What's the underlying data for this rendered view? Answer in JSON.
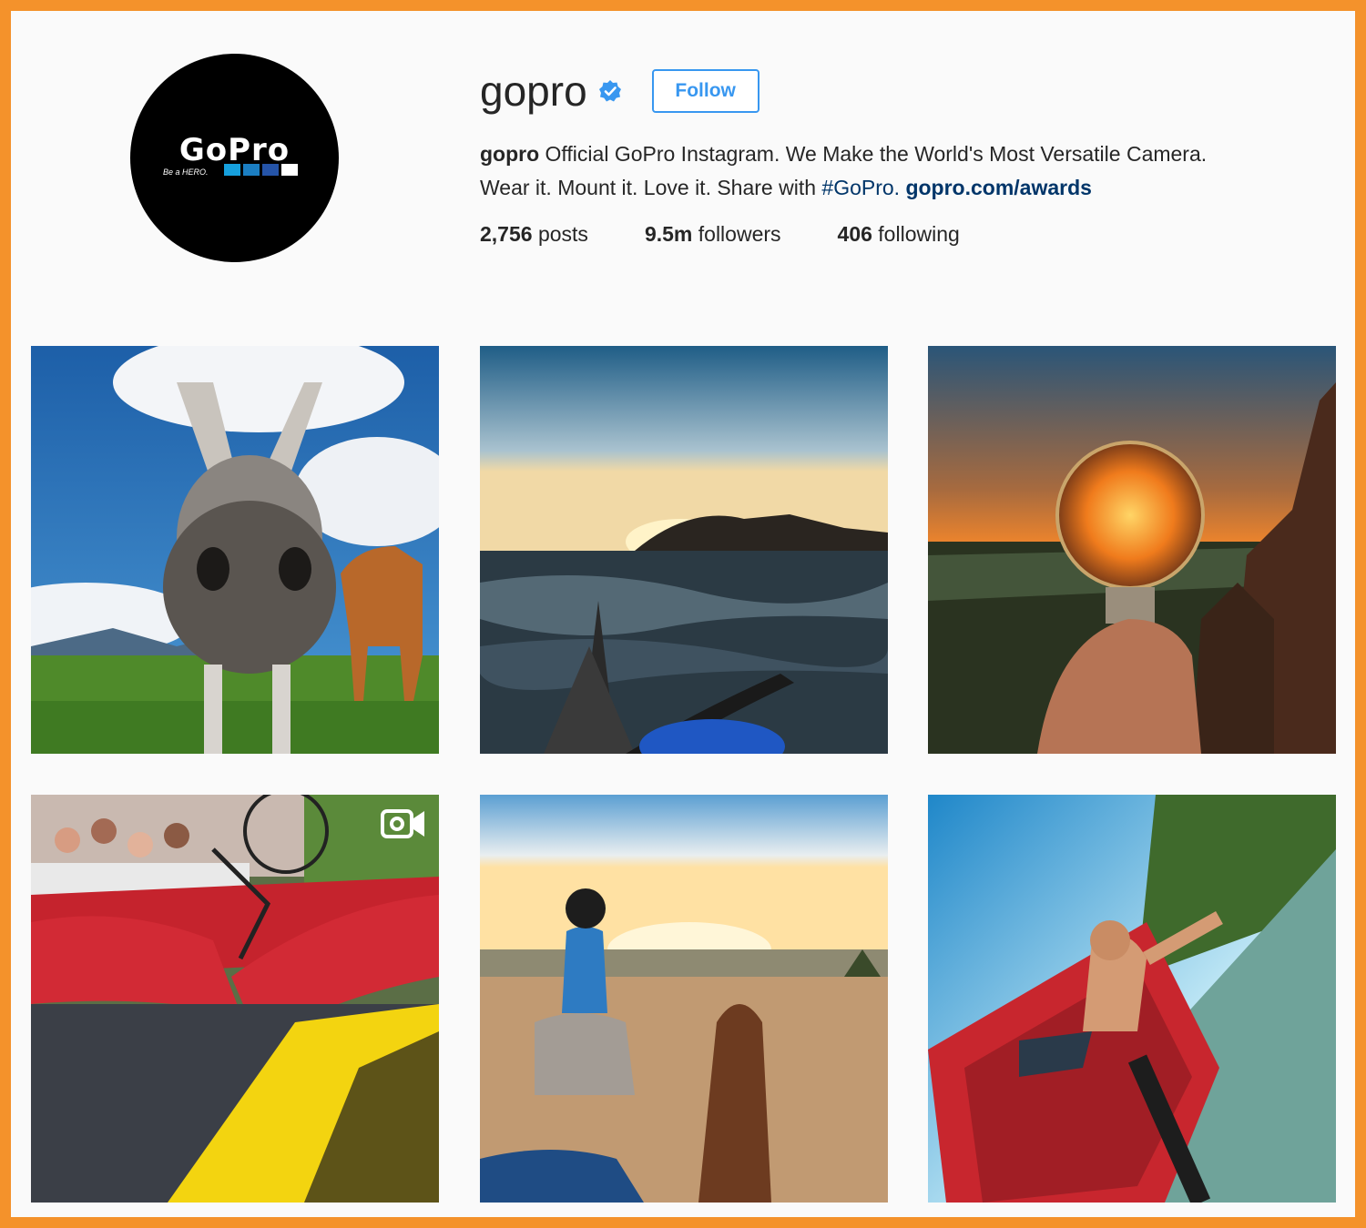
{
  "profile": {
    "username": "gopro",
    "verified": true,
    "follow_label": "Follow",
    "logo_text": "GoPro",
    "logo_tagline": "Be a HERO.",
    "bio_name": "gopro",
    "bio_text_1": "Official GoPro Instagram. We Make the World's Most Versatile Camera.",
    "bio_text_2": "Wear it. Mount it. Love it. Share with",
    "bio_hashtag": "#GoPro.",
    "bio_link": "gopro.com/awards",
    "stats": {
      "posts_count": "2,756",
      "posts_label": "posts",
      "followers_count": "9.5m",
      "followers_label": "followers",
      "following_count": "406",
      "following_label": "following"
    }
  },
  "colors": {
    "accent": "#3897f0",
    "frame": "#f4922b",
    "link": "#003569"
  },
  "posts": [
    {
      "icon": null
    },
    {
      "icon": null
    },
    {
      "icon": null
    },
    {
      "icon": "video-icon"
    },
    {
      "icon": null
    },
    {
      "icon": null
    }
  ]
}
